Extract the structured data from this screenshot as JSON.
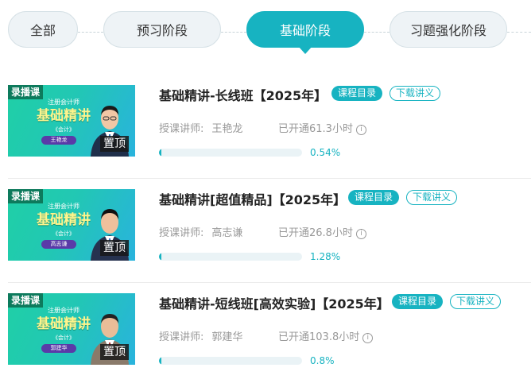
{
  "tabs": [
    {
      "label": "全部",
      "active": false
    },
    {
      "label": "预习阶段",
      "active": false
    },
    {
      "label": "基础阶段",
      "active": true
    },
    {
      "label": "习题强化阶段",
      "active": false
    }
  ],
  "colors": {
    "accent": "#17b3c1",
    "thumb_tag": "#0d7a5c",
    "title_yellow": "#fff58d"
  },
  "courses": [
    {
      "title": "基础精讲-长线班【2025年】",
      "catalog_label": "课程目录",
      "handout_label": "下载讲义",
      "teacher_label": "授课讲师:",
      "teacher": "王艳龙",
      "hours": "已开通61.3小时",
      "progress_text": "0.54%",
      "progress": 0.54,
      "thumb": {
        "tag": "录播课",
        "line1": "注册会计师",
        "line2": "基础精讲",
        "line3": "《会计》",
        "name": "王艳龙",
        "pin": "置顶"
      }
    },
    {
      "title": "基础精讲[超值精品]【2025年】",
      "catalog_label": "课程目录",
      "handout_label": "下载讲义",
      "teacher_label": "授课讲师:",
      "teacher": "高志谦",
      "hours": "已开通26.8小时",
      "progress_text": "1.28%",
      "progress": 1.28,
      "thumb": {
        "tag": "录播课",
        "line1": "注册会计师",
        "line2": "基础精讲",
        "line3": "《会计》",
        "name": "高志谦",
        "pin": "置顶"
      }
    },
    {
      "title": "基础精讲-短线班[高效实验]【2025年】",
      "catalog_label": "课程目录",
      "handout_label": "下载讲义",
      "teacher_label": "授课讲师:",
      "teacher": "郭建华",
      "hours": "已开通103.8小时",
      "progress_text": "0.8%",
      "progress": 0.8,
      "thumb": {
        "tag": "录播课",
        "line1": "注册会计师",
        "line2": "基础精讲",
        "line3": "《会计》",
        "name": "郭建华",
        "pin": "置顶"
      }
    }
  ]
}
